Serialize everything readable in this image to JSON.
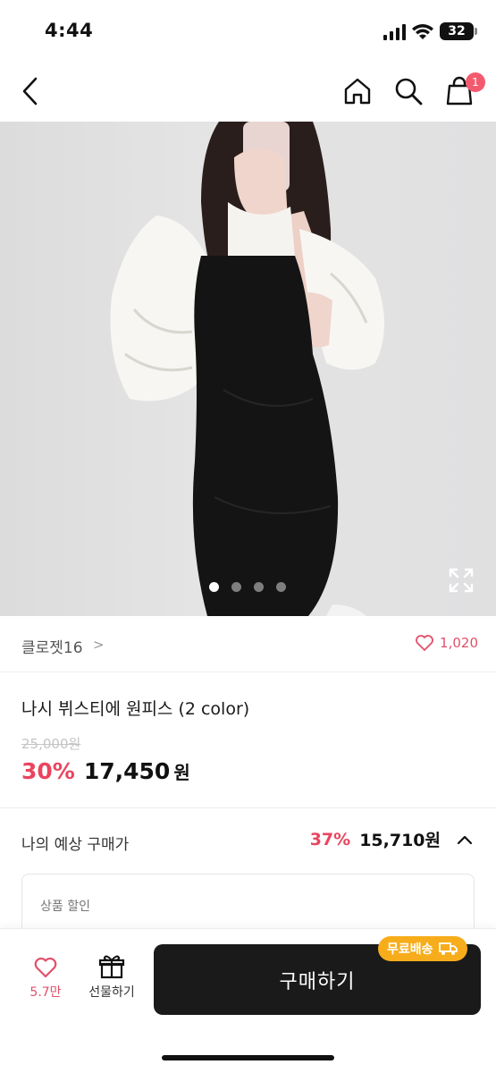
{
  "status_bar": {
    "time": "4:44",
    "battery": "32"
  },
  "header": {
    "cart_count": "1"
  },
  "gallery": {
    "slide_count": 4,
    "active_index": 0
  },
  "brand": {
    "name": "클로젯16",
    "chevron": ">",
    "likes": "1,020"
  },
  "product": {
    "name": "나시 뷔스티에 원피스 (2 color)",
    "original_price": "25,000원",
    "discount": "30%",
    "price": "17,450",
    "currency": "원"
  },
  "expected": {
    "label": "나의 예상 구매가",
    "discount": "37%",
    "price": "15,710원",
    "box_label": "상품 할인"
  },
  "bottom_bar": {
    "like_count": "5.7만",
    "gift_label": "선물하기",
    "buy_label": "구매하기",
    "free_shipping": "무료배송"
  },
  "colors": {
    "accent": "#e9455f",
    "badge": "#f7ad1b",
    "button": "#1a1a1a"
  }
}
